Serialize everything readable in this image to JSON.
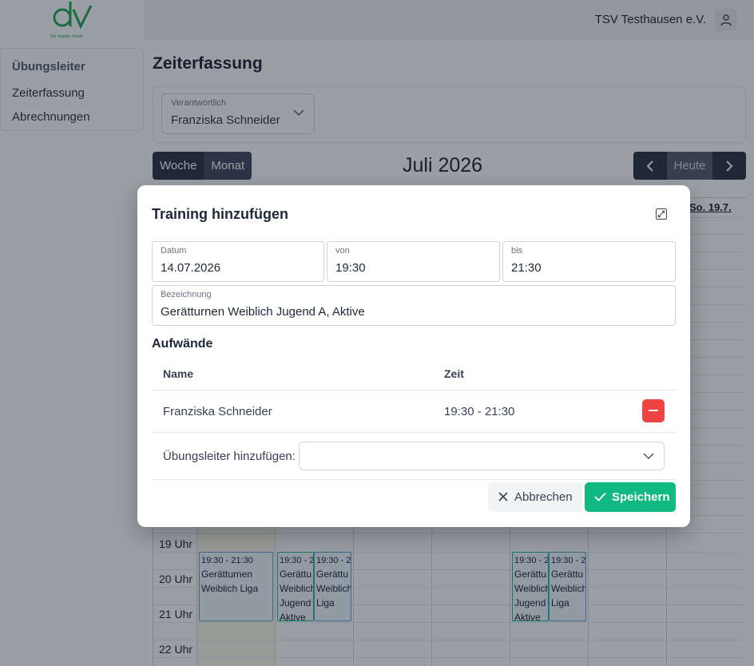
{
  "brand": {
    "logo_text": "dv",
    "logo_tagline": "Der digitale Verein",
    "accent": "#16a34a"
  },
  "header": {
    "org_name": "TSV Testhausen e.V.",
    "user_icon": "user-icon"
  },
  "sidebar": {
    "heading": "Übungsleiter",
    "items": [
      {
        "label": "Zeiterfassung"
      },
      {
        "label": "Abrechnungen"
      }
    ]
  },
  "page": {
    "title": "Zeiterfassung"
  },
  "filter": {
    "label": "Verantwortlich",
    "value": "Franziska Schneider"
  },
  "calendar": {
    "views": [
      {
        "label": "Woche"
      },
      {
        "label": "Monat"
      }
    ],
    "month_title": "Juli 2026",
    "today_label": "Heute",
    "visible_day_header": "So. 19.7.",
    "hours": [
      "19 Uhr",
      "20 Uhr",
      "21 Uhr",
      "22 Uhr"
    ],
    "events": [
      {
        "time": "19:30 - 21:30",
        "title": "Gerätturnen Weiblich Liga"
      },
      {
        "time": "19:30 - 2",
        "title": "Gerättu Weiblich Jugend Aktive"
      },
      {
        "time": "19:30 - 2",
        "title": "Gerättu Weiblich Liga"
      },
      {
        "time": "19:30 - 2",
        "title": "Gerättu Weiblich Jugend Aktive"
      },
      {
        "time": "19:30 - 2",
        "title": "Gerättu Weiblich Liga"
      }
    ]
  },
  "modal": {
    "title": "Training hinzufügen",
    "fields": {
      "date": {
        "label": "Datum",
        "value": "14.07.2026"
      },
      "from": {
        "label": "von",
        "value": "19:30"
      },
      "to": {
        "label": "bis",
        "value": "21:30"
      },
      "name": {
        "label": "Bezeichnung",
        "value": "Gerätturnen Weiblich Jugend A, Aktive"
      }
    },
    "section_title": "Aufwände",
    "table": {
      "columns": [
        "Name",
        "Zeit"
      ],
      "rows": [
        {
          "name": "Franziska Schneider",
          "time": "19:30 - 21:30"
        }
      ]
    },
    "add_label": "Übungsleiter hinzufügen:",
    "add_value": "",
    "cancel_label": "Abbrechen",
    "save_label": "Speichern"
  },
  "colors": {
    "primary_dark": "#1f2937",
    "success": "#10b981",
    "danger": "#ef4444"
  }
}
